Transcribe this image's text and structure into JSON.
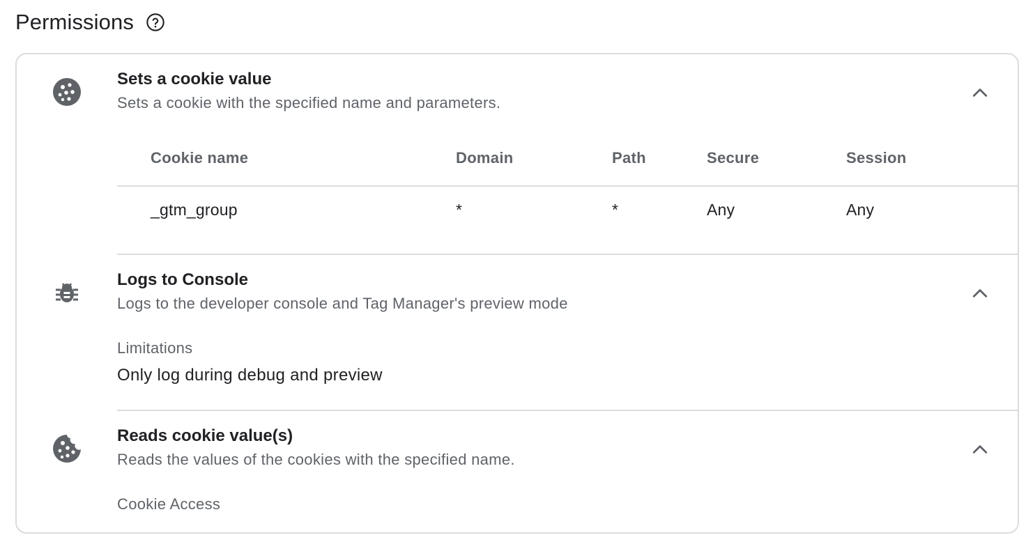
{
  "header": {
    "title": "Permissions",
    "help_icon": "help-circle-icon"
  },
  "permissions": [
    {
      "icon": "cookie-icon",
      "title": "Sets a cookie value",
      "description": "Sets a cookie with the specified name and parameters.",
      "expanded": true,
      "table": {
        "columns": [
          "Cookie name",
          "Domain",
          "Path",
          "Secure",
          "Session"
        ],
        "rows": [
          [
            "_gtm_group",
            "*",
            "*",
            "Any",
            "Any"
          ]
        ]
      }
    },
    {
      "icon": "bug-icon",
      "title": "Logs to Console",
      "description": "Logs to the developer console and Tag Manager's preview mode",
      "expanded": true,
      "limitations_label": "Limitations",
      "limitations_value": "Only log during debug and preview"
    },
    {
      "icon": "cookie-bitten-icon",
      "title": "Reads cookie value(s)",
      "description": "Reads the values of the cookies with the specified name.",
      "expanded": true,
      "access_label": "Cookie Access"
    }
  ],
  "colors": {
    "title": "#202124",
    "secondary": "#5f6368",
    "icon": "#5f6368",
    "border": "#dadce0"
  }
}
